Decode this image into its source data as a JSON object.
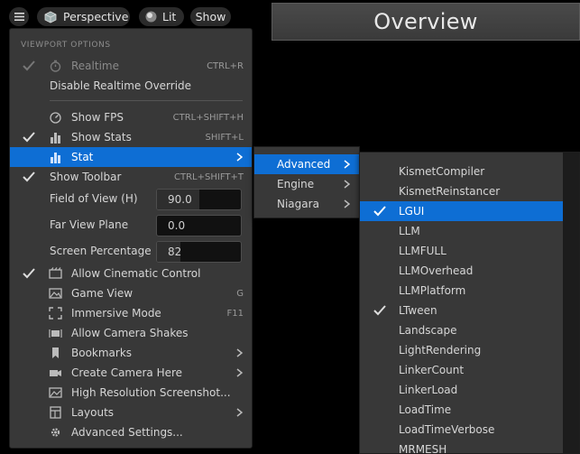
{
  "toolbar": {
    "menu_icon": "hamburger-icon",
    "perspective_label": "Perspective",
    "lit_label": "Lit",
    "show_label": "Show"
  },
  "overview_title": "Overview",
  "viewport_menu": {
    "section_header": "VIEWPORT OPTIONS",
    "realtime": {
      "label": "Realtime",
      "shortcut": "CTRL+R",
      "checked": true,
      "enabled": false
    },
    "disable_realtime": {
      "label": "Disable Realtime Override"
    },
    "show_fps": {
      "label": "Show FPS",
      "shortcut": "CTRL+SHIFT+H"
    },
    "show_stats": {
      "label": "Show Stats",
      "shortcut": "SHIFT+L",
      "checked": true
    },
    "stat": {
      "label": "Stat"
    },
    "show_toolbar": {
      "label": "Show Toolbar",
      "shortcut": "CTRL+SHIFT+T",
      "checked": true
    },
    "fov": {
      "label": "Field of View (H)",
      "value": "90.0",
      "fill_fraction": 0.5
    },
    "far_view": {
      "label": "Far View Plane",
      "value": "0.0"
    },
    "screen_pct": {
      "label": "Screen Percentage",
      "value": "82",
      "fill_fraction": 0.28
    },
    "allow_cinematic": {
      "label": "Allow Cinematic Control",
      "checked": true
    },
    "game_view": {
      "label": "Game View",
      "shortcut": "G"
    },
    "immersive": {
      "label": "Immersive Mode",
      "shortcut": "F11"
    },
    "camera_shakes": {
      "label": "Allow Camera Shakes"
    },
    "bookmarks": {
      "label": "Bookmarks"
    },
    "create_camera": {
      "label": "Create Camera Here"
    },
    "hires": {
      "label": "High Resolution Screenshot..."
    },
    "layouts": {
      "label": "Layouts"
    },
    "advanced_settings": {
      "label": "Advanced Settings..."
    }
  },
  "stat_submenu": [
    "Advanced",
    "Engine",
    "Niagara"
  ],
  "advanced_submenu": [
    {
      "label": "KismetCompiler",
      "checked": false
    },
    {
      "label": "KismetReinstancer",
      "checked": false
    },
    {
      "label": "LGUI",
      "checked": true,
      "selected": true
    },
    {
      "label": "LLM",
      "checked": false
    },
    {
      "label": "LLMFULL",
      "checked": false
    },
    {
      "label": "LLMOverhead",
      "checked": false
    },
    {
      "label": "LLMPlatform",
      "checked": false
    },
    {
      "label": "LTween",
      "checked": true
    },
    {
      "label": "Landscape",
      "checked": false
    },
    {
      "label": "LightRendering",
      "checked": false
    },
    {
      "label": "LinkerCount",
      "checked": false
    },
    {
      "label": "LinkerLoad",
      "checked": false
    },
    {
      "label": "LoadTime",
      "checked": false
    },
    {
      "label": "LoadTimeVerbose",
      "checked": false
    },
    {
      "label": "MRMESH",
      "checked": false
    }
  ],
  "colors": {
    "selection": "#0e6ed4",
    "menu_bg": "#383838"
  }
}
